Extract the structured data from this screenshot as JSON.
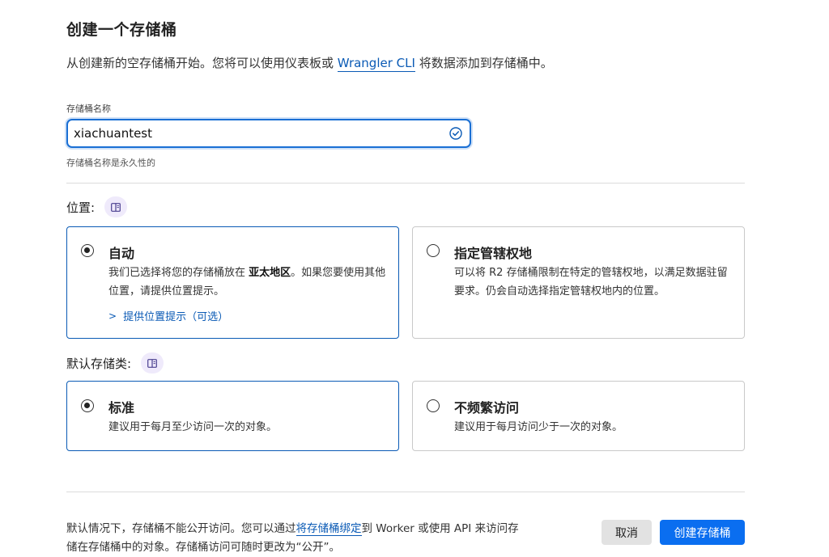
{
  "header": {
    "title": "创建一个存储桶",
    "intro_before": "从创建新的空存储桶开始。您将可以使用仪表板或 ",
    "intro_link": "Wrangler CLI",
    "intro_after": " 将数据添加到存储桶中。"
  },
  "bucket_name": {
    "label": "存储桶名称",
    "value": "xiachuantest",
    "hint": "存储桶名称是永久性的"
  },
  "location": {
    "label": "位置:",
    "options": [
      {
        "title": "自动",
        "desc_before": "我们已选择将您的存储桶放在 ",
        "desc_bold": "亚太地区",
        "desc_after": "。如果您要使用其他位置，请提供位置提示。",
        "hint_link": "提供位置提示（可选）",
        "selected": true
      },
      {
        "title": "指定管辖权地",
        "desc": "可以将 R2 存储桶限制在特定的管辖权地，以满足数据驻留要求。仍会自动选择指定管辖权地内的位置。",
        "selected": false
      }
    ]
  },
  "storage_class": {
    "label": "默认存储类:",
    "options": [
      {
        "title": "标准",
        "desc": "建议用于每月至少访问一次的对象。",
        "selected": true
      },
      {
        "title": "不频繁访问",
        "desc": "建议用于每月访问少于一次的对象。",
        "selected": false
      }
    ]
  },
  "footer": {
    "text_before": "默认情况下，存储桶不能公开访问。您可以通过",
    "text_link": "将存储桶绑定",
    "text_after": "到 Worker 或使用 API 来访问存储在存储桶中的对象。存储桶访问可随时更改为“公开”。",
    "cancel_label": "取消",
    "create_label": "创建存储桶"
  },
  "colors": {
    "accent": "#0a6ef0",
    "link": "#0a5ab5",
    "badge_bg": "#efeafb"
  },
  "icons": {
    "valid": "check-circle-icon",
    "docs": "book-icon",
    "expand": "chevron-right-icon"
  }
}
